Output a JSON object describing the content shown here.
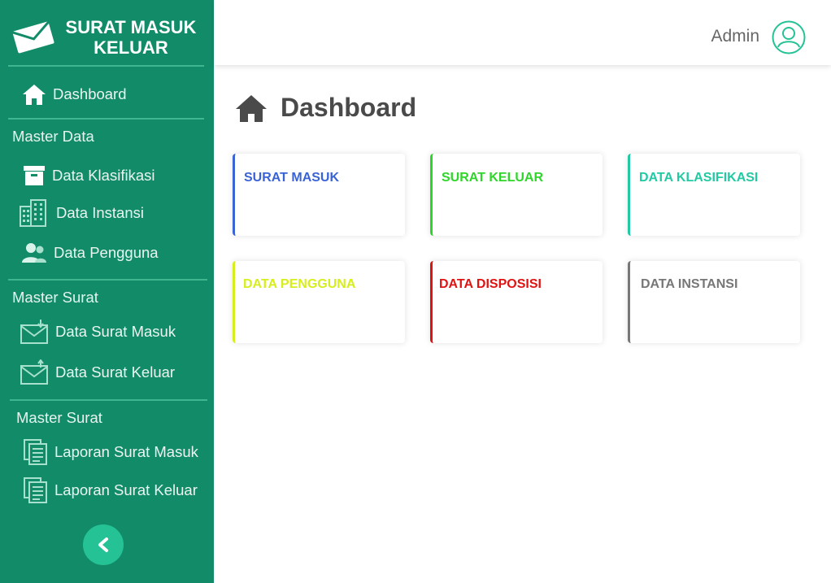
{
  "brand": {
    "title": "SURAT MASUK KELUAR"
  },
  "sidebar": {
    "dashboard": "Dashboard",
    "section_master_data": "Master Data",
    "data_klasifikasi": "Data Klasifikasi",
    "data_instansi": "Data Instansi",
    "data_pengguna": "Data Pengguna",
    "section_master_surat": "Master Surat",
    "data_surat_masuk": "Data Surat Masuk",
    "data_surat_keluar": "Data Surat Keluar",
    "section_master_surat_2": "Master Surat",
    "laporan_surat_masuk": "Laporan Surat Masuk",
    "laporan_surat_keluar": "Laporan Surat Keluar",
    "collapse_icon": "chevron-left-icon"
  },
  "header": {
    "user_name": "Admin",
    "avatar_icon": "user-avatar-icon"
  },
  "main": {
    "title": "Dashboard",
    "cards": [
      {
        "label": "SURAT MASUK",
        "color": "#3a63d6"
      },
      {
        "label": "SURAT KELUAR",
        "color": "#2fd62a"
      },
      {
        "label": "DATA KLASIFIKASI",
        "color": "#22c9a3"
      },
      {
        "label": "DATA PENGGUNA",
        "color": "#d7ee1e"
      },
      {
        "label": "DATA DISPOSISI",
        "color": "#e01313"
      },
      {
        "label": "DATA INSTANSI",
        "color": "#777777"
      }
    ]
  },
  "colors": {
    "sidebar_bg": "#128c68",
    "accent": "#25c296"
  }
}
